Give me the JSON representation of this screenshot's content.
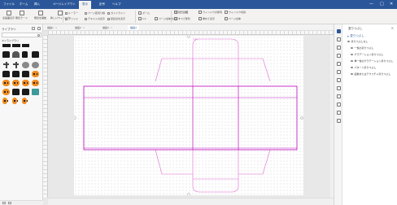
{
  "tabs": [
    "ファイル",
    "ホーム",
    "挿入",
    "ページレイアウト",
    "表示",
    "記号",
    "ヘルプ"
  ],
  "active_tab_index": 4,
  "window": {
    "minimize": "—",
    "maximize": "□",
    "close": "✕"
  },
  "ribbon": {
    "full_screen": "全画面表示",
    "present": "発表モード",
    "start_presentation": "発表を開始",
    "ruler": "ルーラー",
    "page_break": "ページ区切り線",
    "guides": "ガイドライン",
    "grid": "グリッド",
    "vertical_text": "テキストの表示",
    "connection_points": "接続点を表示",
    "zoom": "ズーム",
    "one_to_one": "1:1",
    "fit_page": "ページ全体",
    "fit_width": "ページ幅",
    "whole_page": "ページ全体を表示",
    "new_window": "新しいウィンドウ",
    "full_window": "ウィンドウの整列",
    "arrange_all": "すべて整列",
    "cascade": "重ねて表示",
    "window_switch": "ウィンドウ切替"
  },
  "library": {
    "title": "ライブラリ",
    "search_placeholder": "",
    "subtitle": "マイライブラリ",
    "category": "ハロウィン"
  },
  "doc_tabs": [
    {
      "label": "描画1",
      "active": false
    },
    {
      "label": "描画2",
      "active": false
    },
    {
      "label": "描画3",
      "active": false
    },
    {
      "label": "描画4",
      "active": true
    }
  ],
  "right_panel": {
    "title": "塗りつぶし",
    "section": "塗りつぶし",
    "options": [
      {
        "label": "塗りつぶしなし",
        "on": false,
        "sub": false
      },
      {
        "label": "一色の塗りつぶし",
        "on": false,
        "sub": true
      },
      {
        "label": "グラデーション塗りつぶし",
        "on": false,
        "sub": true
      },
      {
        "label": "単一色のグラデーション塗りつぶし",
        "on": false,
        "sub": true
      },
      {
        "label": "パターン塗りつぶし",
        "on": false,
        "sub": true
      },
      {
        "label": "画像またはテクスチャ塗りつぶし",
        "on": false,
        "sub": true
      }
    ]
  },
  "colors": {
    "accent": "#2b579a",
    "shape_outline": "#c020c0",
    "dieline": "#e06ad0"
  }
}
